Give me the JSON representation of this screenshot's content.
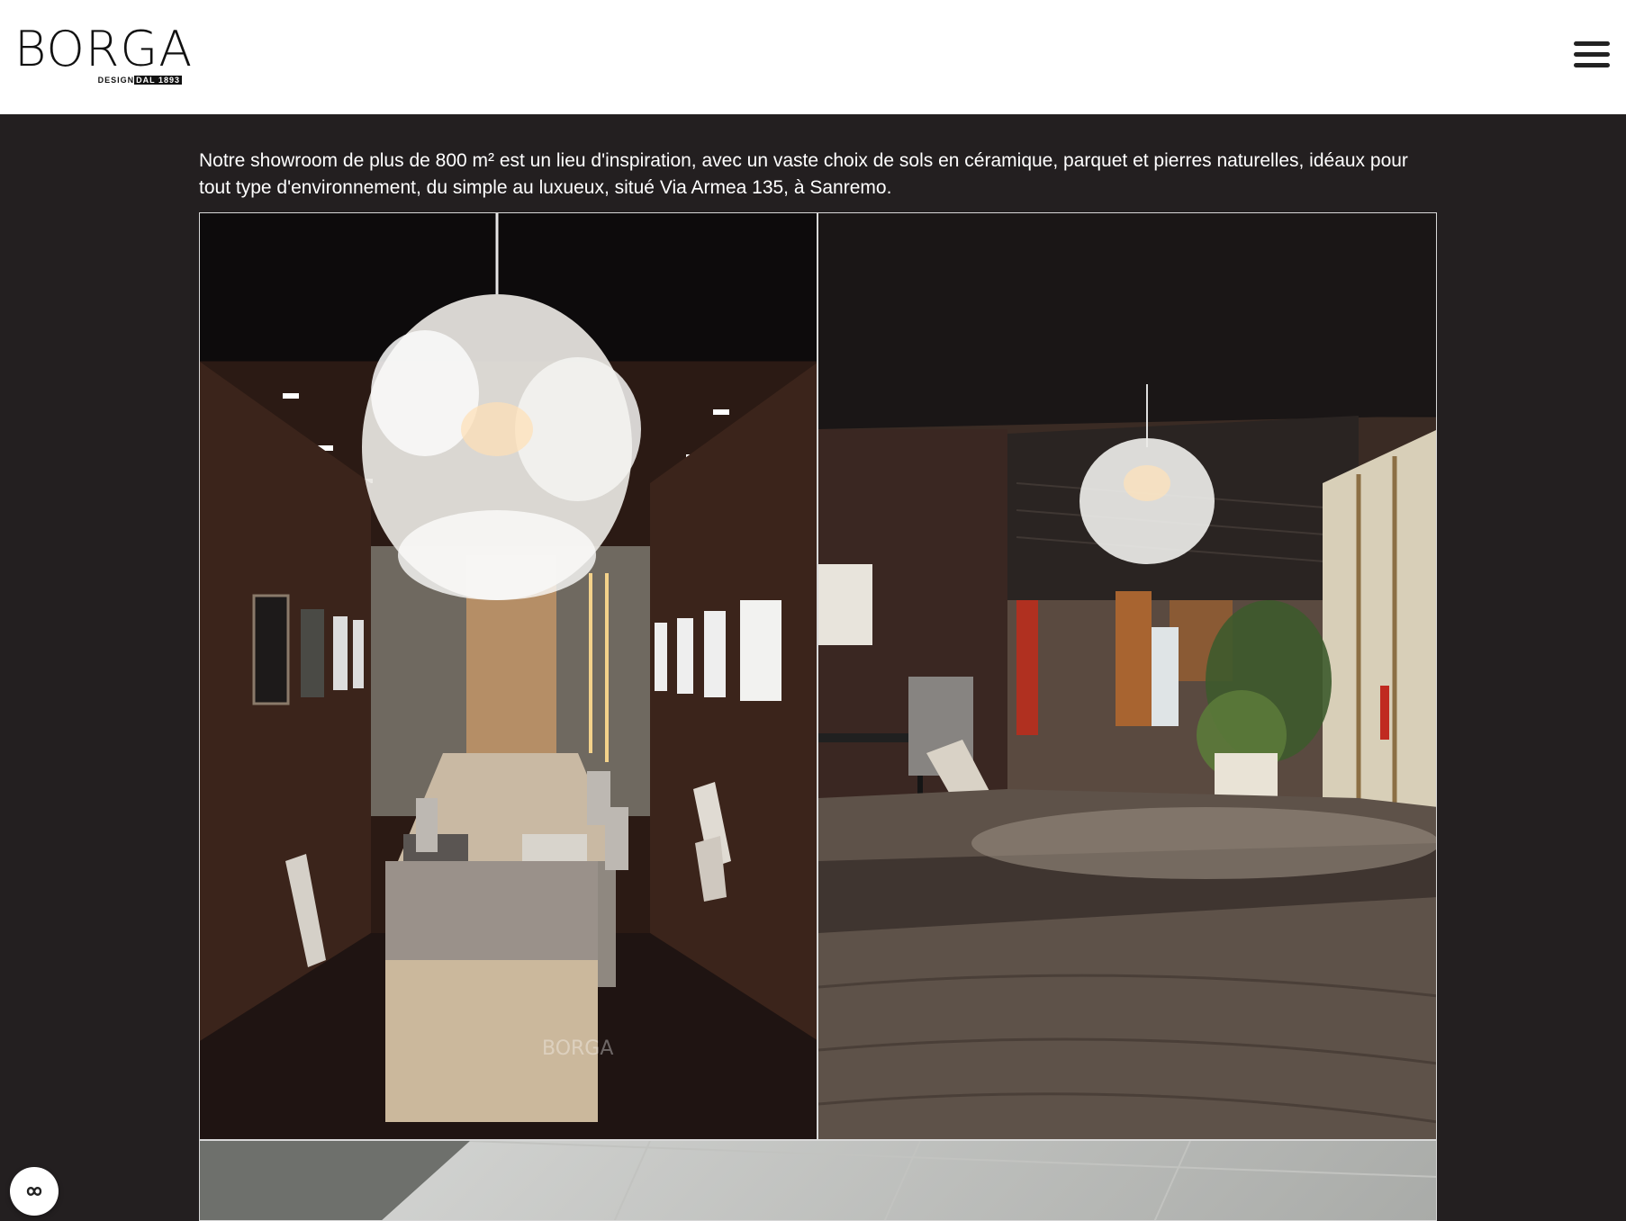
{
  "header": {
    "logo": {
      "word": "BORGA",
      "sub_prefix": "DESIGN",
      "sub_accent": "DAL 1893"
    },
    "menu_icon": "hamburger-menu-icon"
  },
  "intro": {
    "text": "Notre showroom de plus de 800 m² est un lieu d'inspiration, avec un vaste choix de sols en céramique, parquet et pierres naturelles, idéaux pour tout type d'environnement, du simple au luxueux, situé Via Armea 135, à Sanremo."
  },
  "gallery": {
    "photos": [
      {
        "subject": "showroom-corridor-chandelier"
      },
      {
        "subject": "showroom-hall-wood-floor"
      },
      {
        "subject": "showroom-ceiling"
      }
    ],
    "watermark": "BORGA"
  },
  "floating": {
    "icon": "chat-infinity-icon"
  },
  "colors": {
    "page_bg": "#231f20",
    "header_bg": "#ffffff",
    "text": "#ffffff"
  }
}
